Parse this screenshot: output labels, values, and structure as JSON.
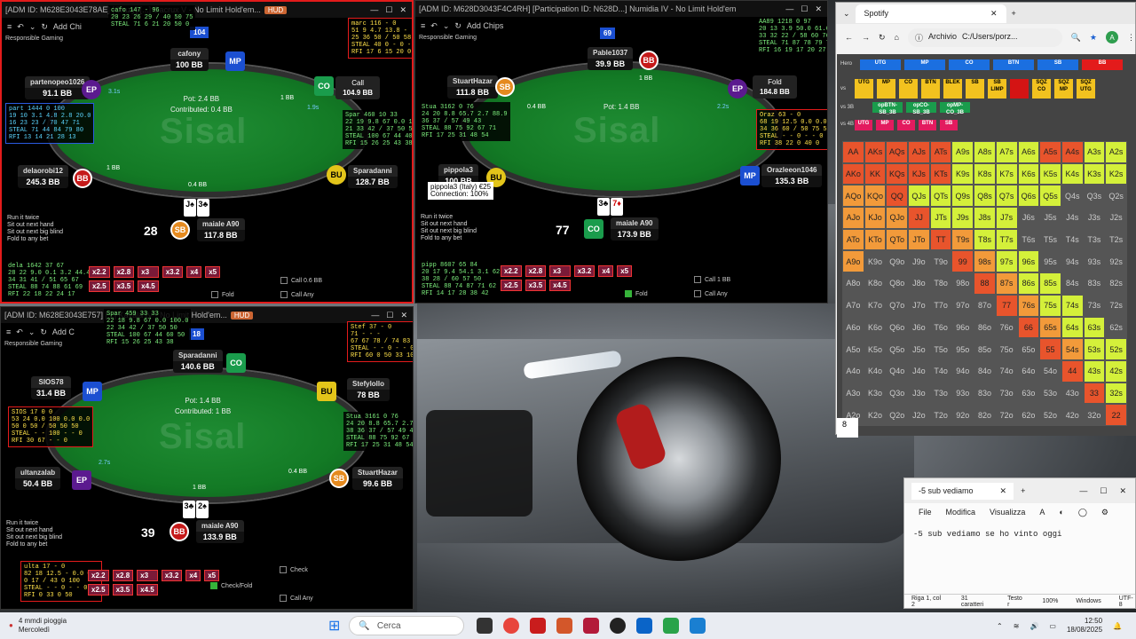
{
  "table1": {
    "title": "[ADM ID: M628E3043E78AE] [Crazy] [...] Gacrux V - No Limit Hold'em...",
    "hud_tag": "HUD",
    "add_chips": "Add Chi",
    "rg": "Responsible Gaming",
    "pot": "Pot: 2.4 BB",
    "contributed": "Contributed: 0.4 BB",
    "table_number": "104",
    "timer": "28",
    "hero_name": "maiale A90",
    "hero_stack": "117.8 BB",
    "hero_cards": [
      "J♠",
      "3♣"
    ],
    "seats": [
      {
        "name": "cafony",
        "stack": "100 BB"
      },
      {
        "name": "partenopeo1026",
        "stack": "91.1 BB"
      },
      {
        "name": "delaorobi12",
        "stack": "245.3 BB"
      },
      {
        "name": "Sparadanni",
        "stack": "128.7 BB"
      }
    ],
    "call_label": "Call",
    "call_amount": "104.9 BB",
    "bets_left": [
      "1 BB",
      "1 BB",
      "0.4 BB",
      "1 BB"
    ],
    "amounts": [
      "3.1s",
      "1.9s"
    ],
    "mp_tag": "MP",
    "pos_labels": [
      "EP",
      "CO",
      "BB",
      "BU",
      "SB"
    ],
    "bet_buttons": [
      "x2.2",
      "x2.8",
      "x3",
      "x3.2",
      "x4",
      "x5",
      "x2.5",
      "x3.5",
      "x4.5"
    ],
    "call_any": "Call Any",
    "call_bb": "Call 0.6 BB",
    "fold": "Fold",
    "hud_top": "marc 116 - 0\n51 9 4.7 13.8 -\n25 36 50 / 50 58 80\nSTEAL 40 0 - 0 -\nRFI 17 6 15 20 0",
    "hud_left": "part 1444 0 100\n19 10 3.1 4.8 2.8 20.0\n16 23 23 / 70 47 71\nSTEAL 71 44 84 79 80\nRFI 13 14 21 28 13",
    "hud_right": "Spar 460 10 33\n22 19 9.8 67 0.0 100.0\n21 33 42 / 37 50 50\nSTEAL 100 67 44 40 50\nRFI 15 26 25 43 38",
    "hud_bottom": "dela 1642 37 67\n28 22 9.0 0.1 3.2 44.4\n34 31 41 / 51 65 67\nSTEAL 88 74 88 61 69\nRFI 22 18 22 24 17",
    "hud_cafo": "cafo 147 - 96\n20 23 26 29 / 40 50 75\nSTEAL 71 6 21 20 50 0",
    "sitout": [
      "Run it twice",
      "Sit out next hand",
      "Sit out next big blind",
      "Fold to any bet"
    ]
  },
  "table2": {
    "title": "[ADM ID: M628D3043F4C4RH] [Participation ID: N628D...] Numidia IV - No Limit Hold'em",
    "add_chips": "Add Chips",
    "rg": "Responsible Gaming",
    "pot": "Pot: 1.4 BB",
    "table_number": "69",
    "timer": "77",
    "hero_name": "maiale A90",
    "hero_stack": "173.9 BB",
    "hero_cards": [
      "3♣",
      "7♦"
    ],
    "seats": [
      {
        "name": "Pable1037",
        "stack": "39.9 BB"
      },
      {
        "name": "StuartHazar",
        "stack": "111.8 BB"
      },
      {
        "name": "pippola3",
        "stack": "100 BB"
      },
      {
        "name": "Orazleeon1046",
        "stack": "135.3 BB"
      }
    ],
    "fold_label": "Fold",
    "fold_amount": "184.8 BB",
    "tooltip": "pippola3 (Italy) €25\nConnection: 100%",
    "amounts": [
      "2.2s"
    ],
    "bets": [
      "0.4 BB",
      "1 BB"
    ],
    "pos_labels": [
      "EP",
      "SB",
      "BB",
      "BU",
      "MP",
      "CO"
    ],
    "bet_buttons": [
      "x2.2",
      "x2.8",
      "x3",
      "x3.2",
      "x4",
      "x5",
      "x2.5",
      "x3.5",
      "x4.5"
    ],
    "call_bb": "Call 1 BB",
    "call_any": "Call Any",
    "fold": "Fold",
    "hud_top": "AA89 1218 0 97\n20 13 3.9 50.0 61.6 67.7\n33 32 22 / 58 60 76\nSTEAL 71 87 78 79 77\nRFI 16 19 17 20 27",
    "hud_left": "Stua 3162 0 76\n24 20 8.8 65.7 2.7 88.9\n36 37 / 57 49 43\nSTEAL 88 75 92 67 71\nRFI 17 25 31 48 54",
    "hud_right": "Oraz 63 - 0\n68 19 12.5 0.0 0.0 0.0\n34 36 60 / 50 75 50\nSTEAL - - 0 - - 0\nRFI 38 22 0 40 0",
    "hud_bottom": "pipp 8607 65 84\n20 17 9.4 54.1 3.1 62.1\n38 28 / 60 57 50\nSTEAL 88 74 87 71 62\nRFI 14 17 28 38 42",
    "sitout": [
      "Run it twice",
      "Sit out next hand",
      "Sit out next big blind",
      "Fold to any bet"
    ]
  },
  "table3": {
    "title": "[ADM ID: M628E3043E757] [...] Kayala IV - No Limit Hold'em...",
    "hud_tag": "HUD",
    "add_chips": "Add C",
    "rg": "Responsible Gaming",
    "pot": "Pot: 1.4 BB",
    "contributed": "Contributed: 1 BB",
    "table_number": "18",
    "timer": "39",
    "hero_name": "maiale A90",
    "hero_stack": "133.9 BB",
    "hero_cards": [
      "3♣",
      "2♠"
    ],
    "seats": [
      {
        "name": "Sparadanni",
        "stack": "140.6 BB"
      },
      {
        "name": "SIOS78",
        "stack": "31.4 BB"
      },
      {
        "name": "Stefylollo",
        "stack": "78 BB"
      },
      {
        "name": "ultanzalab",
        "stack": "50.4 BB"
      },
      {
        "name": "StuartHazar",
        "stack": "99.6 BB"
      }
    ],
    "amounts": [
      "2.7s"
    ],
    "bets": [
      "0.4 BB",
      "1 BB"
    ],
    "pos_labels": [
      "CO",
      "MP",
      "BU",
      "EP",
      "SB",
      "BB"
    ],
    "bet_buttons": [
      "x2.2",
      "x2.8",
      "x3",
      "x3.2",
      "x4",
      "x5",
      "x2.5",
      "x3.5",
      "x4.5"
    ],
    "check": "Check",
    "check_fold": "Check/Fold",
    "call_any": "Call Any",
    "hud_top": "Spar 459 33 33\n22 18 9.8 67 0.0 100.0\n22 34 42 / 37 50 50\nSTEAL 100 67 44 60 50\nRFI 15 26 25 43 38",
    "hud_stef": "Stef 37 - 0\n71 - - -\n67 67 78 / 74 83 100\nSTEAL - - 0 - - 0\nRFI 60 0 50 33 100",
    "hud_sios": "SIOS 17 0 0\n53 24 0.0 100 0.0 0.0\n50 0 50 / 50 50 50\nSTEAL - - 100 - - 0\nRFI 30 67 - - 0",
    "hud_right": "Stua 3161 0 76\n24 20 8.8 65.7 2.7 88.9\n38 36 37 / 57 49 43\nSTEAL 88 75 92 67 71\nRFI 17 25 31 48 54",
    "hud_bottom": "ulta 17 - 0\n82 18 12.5 - 0.0 0.0\n0 17 / 43 0 100\nSTEAL - - 0 - - 0\nRFI 0 33 0 50",
    "sitout": [
      "Run it twice",
      "Sit out next hand",
      "Sit out next big blind",
      "Fold to any bet"
    ]
  },
  "spotify": {
    "tab_title": "Spotify",
    "address_label": "Archivio",
    "address": "C:/Users/porz...",
    "row_labels": [
      "Hero",
      "vs",
      "vs 3B",
      "vs 4B"
    ],
    "hero_buttons": [
      "UTG",
      "MP",
      "CO",
      "BTN",
      "SB",
      "BB"
    ],
    "vs_buttons": [
      "UTG",
      "MP",
      "CO",
      "BTN",
      "BLEK",
      "SB",
      "SB LIMP",
      "",
      "SQZ CO",
      "SQZ MP",
      "SQZ UTG"
    ],
    "vs3b_buttons": [
      "opBTN-SB_3B",
      "opCO-SB_3B",
      "opMP-CO_3B"
    ],
    "vs4b_buttons": [
      "UTG",
      "MP",
      "CO",
      "BTN",
      "SB"
    ],
    "hands": [
      "AA",
      "AKs",
      "AQs",
      "AJs",
      "ATs",
      "A9s",
      "A8s",
      "A7s",
      "A6s",
      "A5s",
      "A4s",
      "A3s",
      "A2s",
      "AKo",
      "KK",
      "KQs",
      "KJs",
      "KTs",
      "K9s",
      "K8s",
      "K7s",
      "K6s",
      "K5s",
      "K4s",
      "K3s",
      "K2s",
      "AQo",
      "KQo",
      "QQ",
      "QJs",
      "QTs",
      "Q9s",
      "Q8s",
      "Q7s",
      "Q6s",
      "Q5s",
      "Q4s",
      "Q3s",
      "Q2s",
      "AJo",
      "KJo",
      "QJo",
      "JJ",
      "JTs",
      "J9s",
      "J8s",
      "J7s",
      "J6s",
      "J5s",
      "J4s",
      "J3s",
      "J2s",
      "ATo",
      "KTo",
      "QTo",
      "JTo",
      "TT",
      "T9s",
      "T8s",
      "T7s",
      "T6s",
      "T5s",
      "T4s",
      "T3s",
      "T2s",
      "A9o",
      "K9o",
      "Q9o",
      "J9o",
      "T9o",
      "99",
      "98s",
      "97s",
      "96s",
      "95s",
      "94s",
      "93s",
      "92s",
      "A8o",
      "K8o",
      "Q8o",
      "J8o",
      "T8o",
      "98o",
      "88",
      "87s",
      "86s",
      "85s",
      "84s",
      "83s",
      "82s",
      "A7o",
      "K7o",
      "Q7o",
      "J7o",
      "T7o",
      "97o",
      "87o",
      "77",
      "76s",
      "75s",
      "74s",
      "73s",
      "72s",
      "A6o",
      "K6o",
      "Q6o",
      "J6o",
      "T6o",
      "96o",
      "86o",
      "76o",
      "66",
      "65s",
      "64s",
      "63s",
      "62s",
      "A5o",
      "K5o",
      "Q5o",
      "J5o",
      "T5o",
      "95o",
      "85o",
      "75o",
      "65o",
      "55",
      "54s",
      "53s",
      "52s",
      "A4o",
      "K4o",
      "Q4o",
      "J4o",
      "T4o",
      "94o",
      "84o",
      "74o",
      "64o",
      "54o",
      "44",
      "43s",
      "42s",
      "A3o",
      "K3o",
      "Q3o",
      "J3o",
      "T3o",
      "93o",
      "83o",
      "73o",
      "63o",
      "53o",
      "43o",
      "33",
      "32s",
      "A2o",
      "K2o",
      "Q2o",
      "J2o",
      "T2o",
      "92o",
      "82o",
      "72o",
      "62o",
      "52o",
      "42o",
      "32o",
      "22"
    ],
    "overlay_value": "8",
    "colors": {
      "raise": "#e8542c",
      "call": "#d4f03a",
      "fold": "#555555",
      "mixed": "#f29a3a"
    }
  },
  "notepad": {
    "tab_title": "-5 sub vediamo",
    "menus": [
      "File",
      "Modifica",
      "Visualizza"
    ],
    "content": "-5 sub vediamo se ho vinto oggi",
    "status": [
      "Riga 1, col 2",
      "31 caratteri",
      "Testo r",
      "100%",
      "Windows",
      "UTF-8"
    ]
  },
  "taskbar": {
    "weather_line1": "4 mmdi pioggia",
    "weather_line2": "Mercoledì",
    "search": "Cerca",
    "time": "12:50",
    "date": "18/08/2025"
  }
}
